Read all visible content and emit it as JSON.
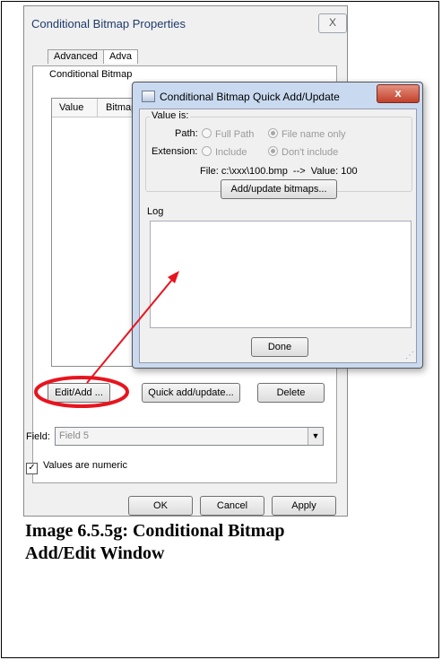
{
  "props_dialog": {
    "title": "Conditional Bitmap Properties",
    "close_glyph": "X",
    "tabs": [
      "Advanced",
      "Adva"
    ],
    "subtitle": "Conditional Bitmap",
    "columns": [
      "Value",
      "Bitmap"
    ],
    "buttons": {
      "edit_add": "Edit/Add ...",
      "quick_add": "Quick add/update...",
      "delete": "Delete"
    },
    "field": {
      "label": "Field:",
      "value": "Field 5"
    },
    "numeric_checkbox": {
      "label": "Values are numeric",
      "checked": true,
      "mark": "✓"
    },
    "footer": {
      "ok": "OK",
      "cancel": "Cancel",
      "apply": "Apply"
    }
  },
  "quick_dialog": {
    "title": "Conditional Bitmap Quick Add/Update",
    "close_glyph": "x",
    "group_title": "Value is:",
    "path": {
      "label": "Path:",
      "options": [
        "Full Path",
        "File name only"
      ],
      "selected": "File name only"
    },
    "extension": {
      "label": "Extension:",
      "options": [
        "Include",
        "Don't include"
      ],
      "selected": "Don't include"
    },
    "example": "File: c:\\xxx\\100.bmp  -->  Value: 100",
    "add_button": "Add/update bitmaps...",
    "log_label": "Log",
    "done_button": "Done"
  },
  "annotation": {
    "color": "#e8141e"
  },
  "caption": {
    "line1": "Image 6.5.5g: Conditional Bitmap",
    "line2": "Add/Edit Window"
  }
}
